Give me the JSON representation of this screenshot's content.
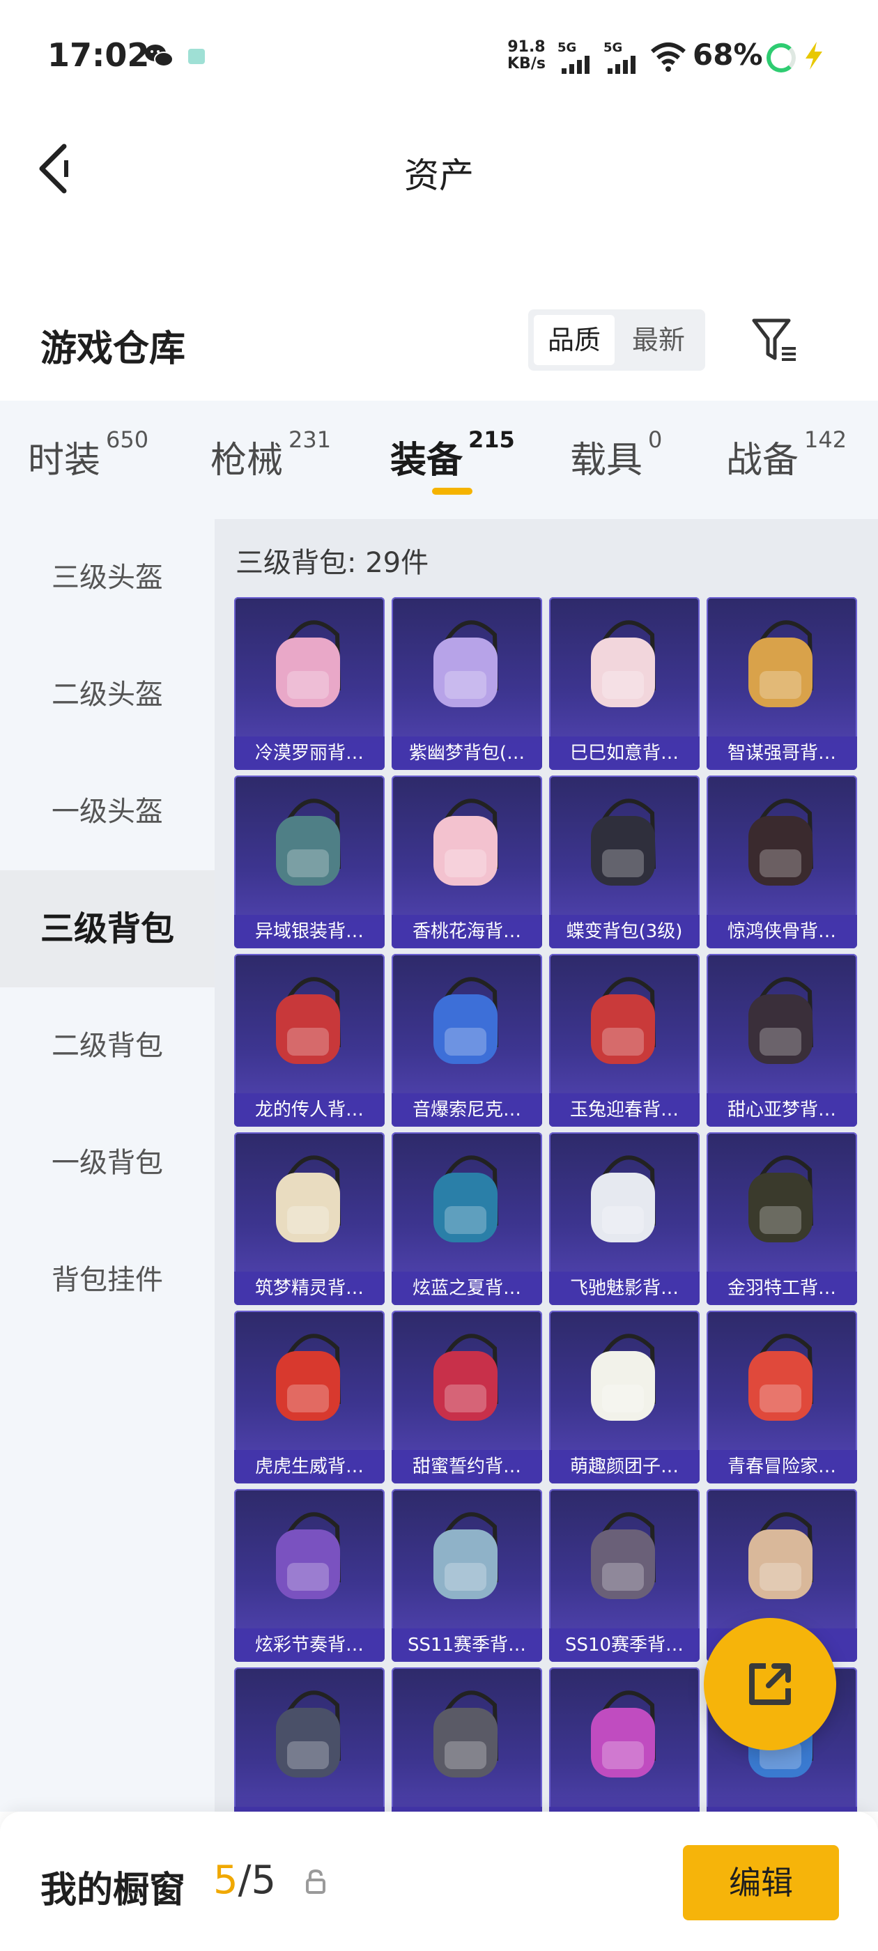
{
  "status_bar": {
    "time": "17:02",
    "net_speed_value": "91.8",
    "net_speed_unit": "KB/s",
    "signal1": "5G",
    "signal2": "5G",
    "battery": "68%"
  },
  "nav": {
    "title": "资产"
  },
  "warehouse": {
    "title": "游戏仓库",
    "sort": {
      "active": "品质",
      "inactive": "最新"
    }
  },
  "tabs": [
    {
      "label": "时装",
      "count": "650"
    },
    {
      "label": "枪械",
      "count": "231"
    },
    {
      "label": "装备",
      "count": "215"
    },
    {
      "label": "载具",
      "count": "0"
    },
    {
      "label": "战备",
      "count": "142"
    }
  ],
  "sidebar": [
    {
      "label": "三级头盔"
    },
    {
      "label": "二级头盔"
    },
    {
      "label": "一级头盔"
    },
    {
      "label": "三级背包"
    },
    {
      "label": "二级背包"
    },
    {
      "label": "一级背包"
    },
    {
      "label": "背包挂件"
    }
  ],
  "content": {
    "heading": "三级背包: 29件",
    "items": [
      {
        "name": "冷漠罗丽背…",
        "color": "#e9a8c8"
      },
      {
        "name": "紫幽梦背包(…",
        "color": "#b7a3e8"
      },
      {
        "name": "巳巳如意背…",
        "color": "#f2d6dc"
      },
      {
        "name": "智谋强哥背…",
        "color": "#d9a24a"
      },
      {
        "name": "异域银装背…",
        "color": "#4f7f86"
      },
      {
        "name": "香桃花海背…",
        "color": "#f3c2cf"
      },
      {
        "name": "蝶变背包(3级)",
        "color": "#2f2f3c"
      },
      {
        "name": "惊鸿侠骨背…",
        "color": "#3a2a2e"
      },
      {
        "name": "龙的传人背…",
        "color": "#c8383a"
      },
      {
        "name": "音爆索尼克…",
        "color": "#3d6fd8"
      },
      {
        "name": "玉兔迎春背…",
        "color": "#c93a3a"
      },
      {
        "name": "甜心亚梦背…",
        "color": "#3a2f3a"
      },
      {
        "name": "筑梦精灵背…",
        "color": "#e9dcc0"
      },
      {
        "name": "炫蓝之夏背…",
        "color": "#2a7fa8"
      },
      {
        "name": "飞驰魅影背…",
        "color": "#e6e9f0"
      },
      {
        "name": "金羽特工背…",
        "color": "#3a3a2c"
      },
      {
        "name": "虎虎生威背…",
        "color": "#d8392e"
      },
      {
        "name": "甜蜜誓约背…",
        "color": "#c8304a"
      },
      {
        "name": "萌趣颜团子…",
        "color": "#f2f2ea"
      },
      {
        "name": "青春冒险家…",
        "color": "#e0493b"
      },
      {
        "name": "炫彩节奏背…",
        "color": "#7a52c0"
      },
      {
        "name": "SS11赛季背…",
        "color": "#8fb2c8"
      },
      {
        "name": "SS10赛季背…",
        "color": "#6a6078"
      },
      {
        "name": "",
        "color": "#d9b89a"
      },
      {
        "name": "",
        "color": "#4a5068"
      },
      {
        "name": "",
        "color": "#5a5a66"
      },
      {
        "name": "",
        "color": "#c04cc0"
      },
      {
        "name": "",
        "color": "#3a7ad0"
      }
    ]
  },
  "showcase": {
    "title": "我的橱窗",
    "count_current": "5",
    "count_total": "/5",
    "edit_label": "编辑"
  },
  "colors": {
    "accent": "#f6b40a",
    "card_bg": "#3d3590",
    "label_bg": "#4234aa"
  }
}
